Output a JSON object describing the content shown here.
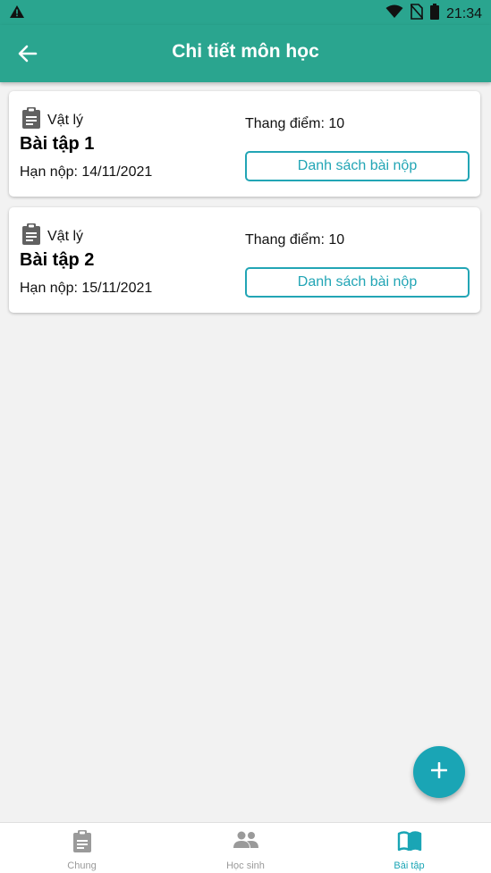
{
  "status_bar": {
    "time": "21:34"
  },
  "app_bar": {
    "title": "Chi tiết môn học",
    "back_icon": "arrow-left-icon"
  },
  "assignments": [
    {
      "subject": "Vật lý",
      "name": "Bài tập 1",
      "deadline": "Hạn nộp: 14/11/2021",
      "scale": "Thang điểm: 10",
      "button": "Danh sách bài nộp"
    },
    {
      "subject": "Vật lý",
      "name": "Bài tập 2",
      "deadline": "Hạn nộp: 15/11/2021",
      "scale": "Thang điểm: 10",
      "button": "Danh sách bài nộp"
    }
  ],
  "fab": {
    "icon": "plus-icon"
  },
  "bottom_nav": {
    "tabs": [
      {
        "label": "Chung",
        "icon": "clipboard-icon",
        "active": false
      },
      {
        "label": "Học sinh",
        "icon": "people-icon",
        "active": false
      },
      {
        "label": "Bài tập",
        "icon": "book-icon",
        "active": true
      }
    ]
  },
  "colors": {
    "primary": "#2aa58f",
    "accent": "#1aa5b5",
    "inactive": "#9a9a9a"
  }
}
